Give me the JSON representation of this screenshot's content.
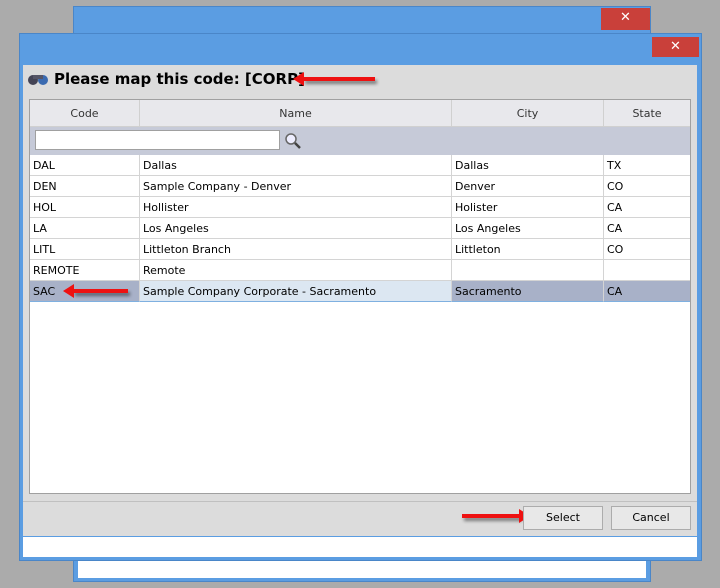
{
  "dialog": {
    "title": "Please map this code: [CORP]",
    "close_icon": "✕"
  },
  "grid": {
    "columns": [
      "Code",
      "Name",
      "City",
      "State"
    ],
    "filter": {
      "value": "",
      "placeholder": ""
    },
    "rows": [
      {
        "code": "DAL",
        "name": "Dallas",
        "city": "Dallas",
        "state": "TX"
      },
      {
        "code": "DEN",
        "name": "Sample Company - Denver",
        "city": "Denver",
        "state": "CO"
      },
      {
        "code": "HOL",
        "name": "Hollister",
        "city": "Holister",
        "state": "CA"
      },
      {
        "code": "LA",
        "name": "Los Angeles",
        "city": "Los Angeles",
        "state": "CA"
      },
      {
        "code": "LITL",
        "name": "Littleton Branch",
        "city": "Littleton",
        "state": "CO"
      },
      {
        "code": "REMOTE",
        "name": "Remote",
        "city": "",
        "state": ""
      },
      {
        "code": "SAC",
        "name": "Sample Company Corporate - Sacramento",
        "city": "Sacramento",
        "state": "CA"
      }
    ],
    "selected_index": 6
  },
  "buttons": {
    "select": "Select",
    "cancel": "Cancel"
  },
  "colors": {
    "titlebar": "#5b9de2",
    "close": "#c9403a",
    "selected_row": "#a8b1c8",
    "arrow": "#ee1111"
  }
}
